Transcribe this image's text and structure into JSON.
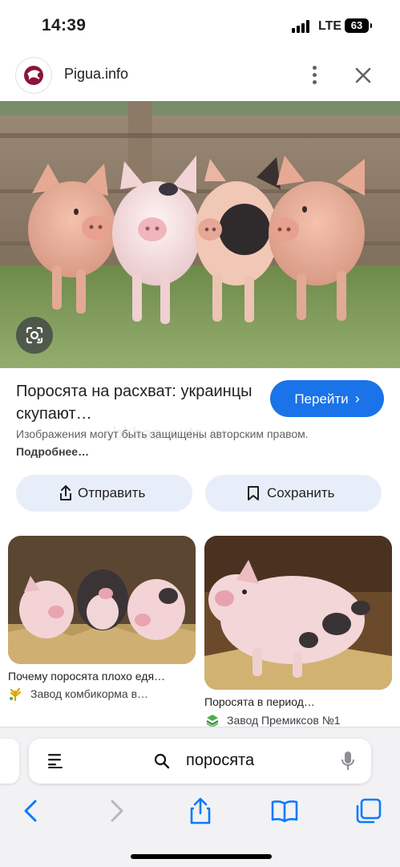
{
  "status_bar": {
    "time": "14:39",
    "network": "LTE",
    "battery": "63"
  },
  "site": {
    "name": "Pigua.info"
  },
  "result": {
    "title": "Поросята на расхват: украинцы скупают…",
    "visit_label": "Перейти",
    "copyright_text": "Изображения могут быть защищены авторским правом.",
    "more_link": "Подробнее…",
    "watermark": "abkhaz-auto.ru",
    "share_label": "Отправить",
    "save_label": "Сохранить"
  },
  "related": [
    {
      "title": "Почему поросята плохо едя…",
      "source": "Завод комбикорма в…"
    },
    {
      "title": "Поросята в период…",
      "source": "Завод Премиксов №1"
    }
  ],
  "search": {
    "query": "поросята"
  },
  "icons": {
    "site_logo": "pigua-logo",
    "more": "more-vertical-icon",
    "close": "close-icon",
    "lens": "lens-icon",
    "share": "share-icon",
    "bookmark": "bookmark-icon",
    "reader": "reader-icon",
    "search": "search-icon",
    "mic": "mic-icon",
    "back": "back-icon",
    "forward": "forward-icon",
    "tabs": "tabs-icon",
    "book": "bookmarks-icon"
  },
  "colors": {
    "accent": "#1a73e8",
    "chip_bg": "#e8eef9",
    "logo": "#8a1538",
    "ios_blue": "#0a7aff"
  }
}
